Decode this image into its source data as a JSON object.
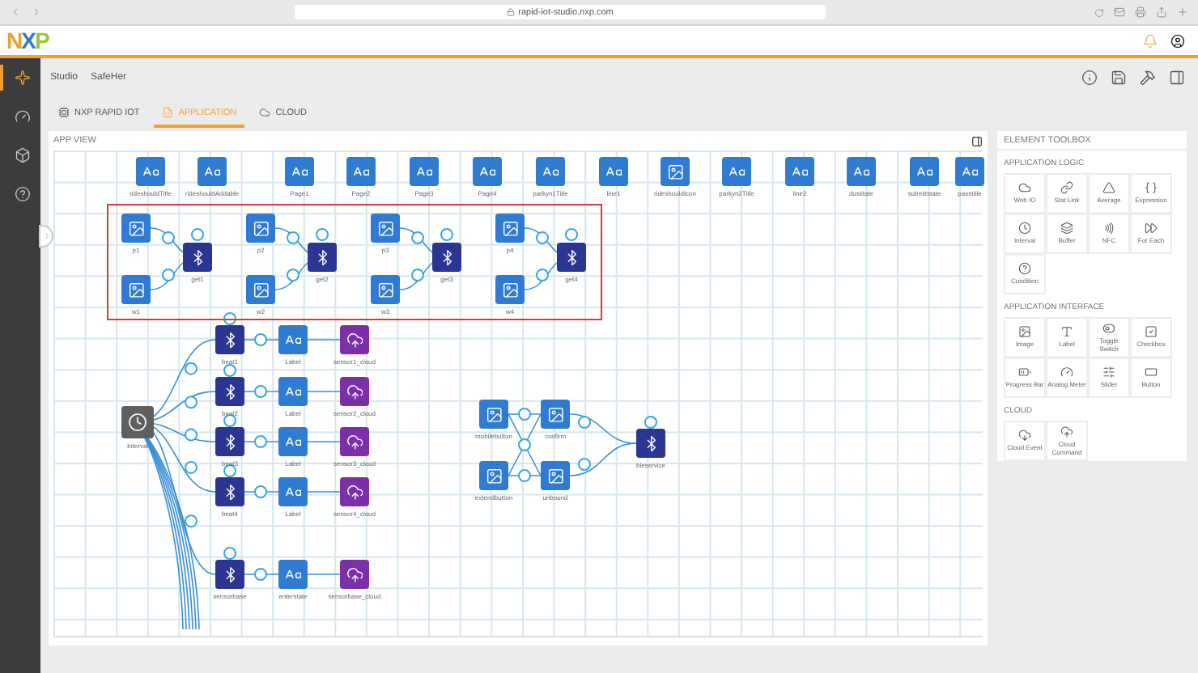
{
  "browser": {
    "url": "rapid-iot-studio.nxp.com"
  },
  "header": {
    "logo": "NXP"
  },
  "sidebar": {
    "items": [
      {
        "selected": true
      },
      {
        "selected": false
      },
      {
        "selected": false
      },
      {
        "selected": false
      }
    ]
  },
  "breadcrumb": [
    "Studio",
    "SafeHer"
  ],
  "tabs": [
    {
      "label": "NXP RAPID IOT",
      "selected": false
    },
    {
      "label": "APPLICATION",
      "selected": true
    },
    {
      "label": "CLOUD",
      "selected": false
    }
  ],
  "app_view": {
    "title": "APP VIEW",
    "top_nodes": [
      {
        "label": "rideshouldTitle",
        "kind": "label"
      },
      {
        "label": "rideshouldAddable",
        "kind": "label"
      },
      {
        "label": "Page1",
        "kind": "label"
      },
      {
        "label": "Page2",
        "kind": "label"
      },
      {
        "label": "Page3",
        "kind": "label"
      },
      {
        "label": "Page4",
        "kind": "label"
      },
      {
        "label": "parkyn1Title",
        "kind": "label"
      },
      {
        "label": "line1",
        "kind": "label"
      },
      {
        "label": "rideshouldIcon",
        "kind": "image"
      },
      {
        "label": "parkyn2Title",
        "kind": "label"
      },
      {
        "label": "line2",
        "kind": "label"
      },
      {
        "label": "dustitate",
        "kind": "label"
      },
      {
        "label": "submitstate",
        "kind": "label"
      },
      {
        "label": "passtitle",
        "kind": "label"
      }
    ],
    "groups": [
      {
        "inputs": [
          "p1",
          "w1"
        ],
        "output": "get1"
      },
      {
        "inputs": [
          "p2",
          "w2"
        ],
        "output": "get2"
      },
      {
        "inputs": [
          "p3",
          "w3"
        ],
        "output": "get3"
      },
      {
        "inputs": [
          "p4",
          "w4"
        ],
        "output": "get4"
      }
    ],
    "timer": "Interval",
    "flows": [
      {
        "source": "beat1",
        "label": "Label",
        "cloud": "sensor1_cloud"
      },
      {
        "source": "beat2",
        "label": "Label",
        "cloud": "sensor2_cloud"
      },
      {
        "source": "beat3",
        "label": "Label",
        "cloud": "sensor3_cloud"
      },
      {
        "source": "beat4",
        "label": "Label",
        "cloud": "sensor4_cloud"
      },
      {
        "source": "sensorbase",
        "label": "enterstate",
        "cloud": "sensorbase_cloud"
      }
    ],
    "buttons": [
      "mobilebutton",
      "extendbutton",
      "confirm",
      "unbound"
    ],
    "ble": "bleservice"
  },
  "toolbox": {
    "title": "ELEMENT TOOLBOX",
    "sections": [
      {
        "title": "APPLICATION LOGIC",
        "items": [
          "Web IO",
          "Stat Link",
          "Average",
          "Expression",
          "Interval",
          "Buffer",
          "NFC",
          "For Each",
          "Condition"
        ]
      },
      {
        "title": "APPLICATION INTERFACE",
        "items": [
          "Image",
          "Label",
          "Toggle Switch",
          "Checkbox",
          "Progress Bar",
          "Analog Meter",
          "Slider",
          "Button"
        ]
      },
      {
        "title": "CLOUD",
        "items": [
          "Cloud Event",
          "Cloud Command"
        ]
      }
    ]
  }
}
